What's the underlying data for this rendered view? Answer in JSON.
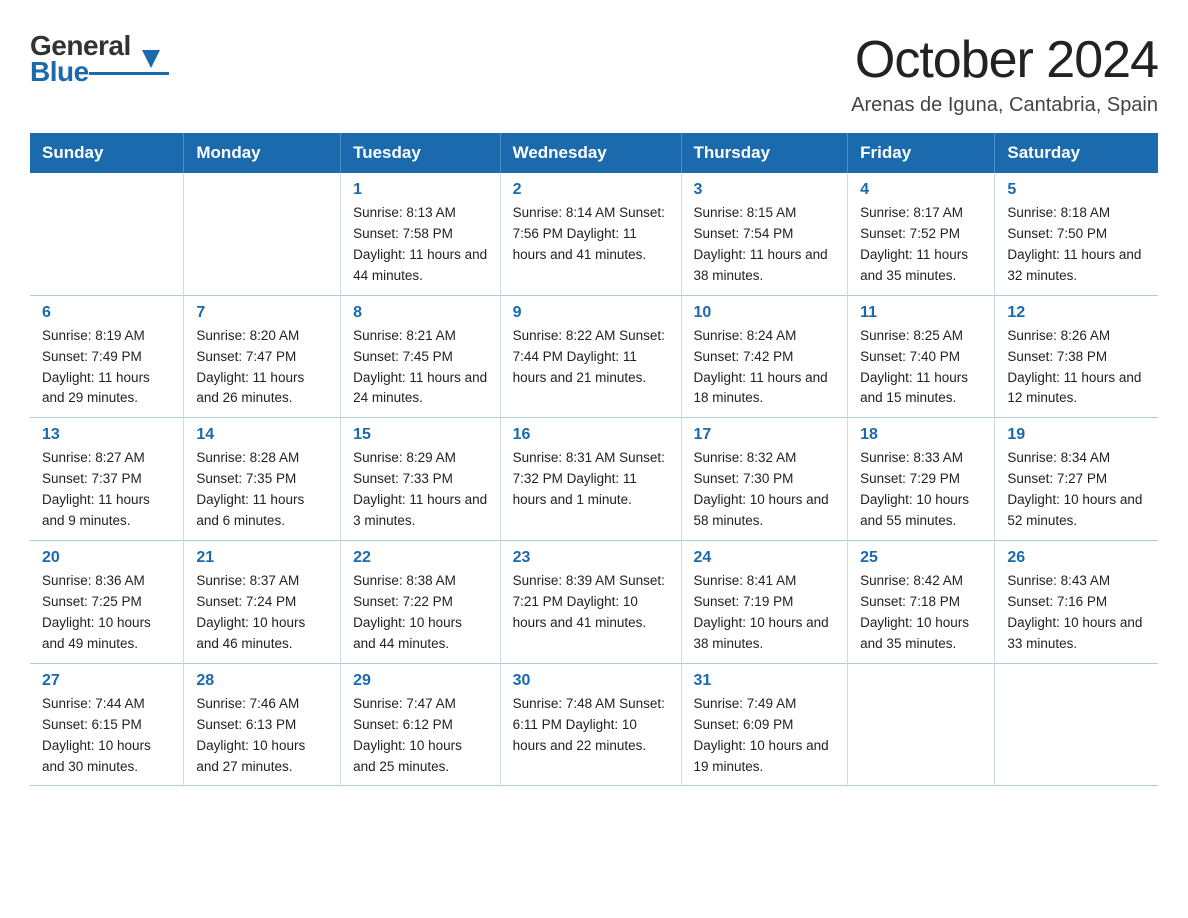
{
  "logo": {
    "general": "General",
    "triangle": "▶",
    "blue": "Blue"
  },
  "title": "October 2024",
  "subtitle": "Arenas de Iguna, Cantabria, Spain",
  "weekdays": [
    "Sunday",
    "Monday",
    "Tuesday",
    "Wednesday",
    "Thursday",
    "Friday",
    "Saturday"
  ],
  "weeks": [
    [
      {
        "num": "",
        "info": ""
      },
      {
        "num": "",
        "info": ""
      },
      {
        "num": "1",
        "info": "Sunrise: 8:13 AM\nSunset: 7:58 PM\nDaylight: 11 hours\nand 44 minutes."
      },
      {
        "num": "2",
        "info": "Sunrise: 8:14 AM\nSunset: 7:56 PM\nDaylight: 11 hours\nand 41 minutes."
      },
      {
        "num": "3",
        "info": "Sunrise: 8:15 AM\nSunset: 7:54 PM\nDaylight: 11 hours\nand 38 minutes."
      },
      {
        "num": "4",
        "info": "Sunrise: 8:17 AM\nSunset: 7:52 PM\nDaylight: 11 hours\nand 35 minutes."
      },
      {
        "num": "5",
        "info": "Sunrise: 8:18 AM\nSunset: 7:50 PM\nDaylight: 11 hours\nand 32 minutes."
      }
    ],
    [
      {
        "num": "6",
        "info": "Sunrise: 8:19 AM\nSunset: 7:49 PM\nDaylight: 11 hours\nand 29 minutes."
      },
      {
        "num": "7",
        "info": "Sunrise: 8:20 AM\nSunset: 7:47 PM\nDaylight: 11 hours\nand 26 minutes."
      },
      {
        "num": "8",
        "info": "Sunrise: 8:21 AM\nSunset: 7:45 PM\nDaylight: 11 hours\nand 24 minutes."
      },
      {
        "num": "9",
        "info": "Sunrise: 8:22 AM\nSunset: 7:44 PM\nDaylight: 11 hours\nand 21 minutes."
      },
      {
        "num": "10",
        "info": "Sunrise: 8:24 AM\nSunset: 7:42 PM\nDaylight: 11 hours\nand 18 minutes."
      },
      {
        "num": "11",
        "info": "Sunrise: 8:25 AM\nSunset: 7:40 PM\nDaylight: 11 hours\nand 15 minutes."
      },
      {
        "num": "12",
        "info": "Sunrise: 8:26 AM\nSunset: 7:38 PM\nDaylight: 11 hours\nand 12 minutes."
      }
    ],
    [
      {
        "num": "13",
        "info": "Sunrise: 8:27 AM\nSunset: 7:37 PM\nDaylight: 11 hours\nand 9 minutes."
      },
      {
        "num": "14",
        "info": "Sunrise: 8:28 AM\nSunset: 7:35 PM\nDaylight: 11 hours\nand 6 minutes."
      },
      {
        "num": "15",
        "info": "Sunrise: 8:29 AM\nSunset: 7:33 PM\nDaylight: 11 hours\nand 3 minutes."
      },
      {
        "num": "16",
        "info": "Sunrise: 8:31 AM\nSunset: 7:32 PM\nDaylight: 11 hours\nand 1 minute."
      },
      {
        "num": "17",
        "info": "Sunrise: 8:32 AM\nSunset: 7:30 PM\nDaylight: 10 hours\nand 58 minutes."
      },
      {
        "num": "18",
        "info": "Sunrise: 8:33 AM\nSunset: 7:29 PM\nDaylight: 10 hours\nand 55 minutes."
      },
      {
        "num": "19",
        "info": "Sunrise: 8:34 AM\nSunset: 7:27 PM\nDaylight: 10 hours\nand 52 minutes."
      }
    ],
    [
      {
        "num": "20",
        "info": "Sunrise: 8:36 AM\nSunset: 7:25 PM\nDaylight: 10 hours\nand 49 minutes."
      },
      {
        "num": "21",
        "info": "Sunrise: 8:37 AM\nSunset: 7:24 PM\nDaylight: 10 hours\nand 46 minutes."
      },
      {
        "num": "22",
        "info": "Sunrise: 8:38 AM\nSunset: 7:22 PM\nDaylight: 10 hours\nand 44 minutes."
      },
      {
        "num": "23",
        "info": "Sunrise: 8:39 AM\nSunset: 7:21 PM\nDaylight: 10 hours\nand 41 minutes."
      },
      {
        "num": "24",
        "info": "Sunrise: 8:41 AM\nSunset: 7:19 PM\nDaylight: 10 hours\nand 38 minutes."
      },
      {
        "num": "25",
        "info": "Sunrise: 8:42 AM\nSunset: 7:18 PM\nDaylight: 10 hours\nand 35 minutes."
      },
      {
        "num": "26",
        "info": "Sunrise: 8:43 AM\nSunset: 7:16 PM\nDaylight: 10 hours\nand 33 minutes."
      }
    ],
    [
      {
        "num": "27",
        "info": "Sunrise: 7:44 AM\nSunset: 6:15 PM\nDaylight: 10 hours\nand 30 minutes."
      },
      {
        "num": "28",
        "info": "Sunrise: 7:46 AM\nSunset: 6:13 PM\nDaylight: 10 hours\nand 27 minutes."
      },
      {
        "num": "29",
        "info": "Sunrise: 7:47 AM\nSunset: 6:12 PM\nDaylight: 10 hours\nand 25 minutes."
      },
      {
        "num": "30",
        "info": "Sunrise: 7:48 AM\nSunset: 6:11 PM\nDaylight: 10 hours\nand 22 minutes."
      },
      {
        "num": "31",
        "info": "Sunrise: 7:49 AM\nSunset: 6:09 PM\nDaylight: 10 hours\nand 19 minutes."
      },
      {
        "num": "",
        "info": ""
      },
      {
        "num": "",
        "info": ""
      }
    ]
  ]
}
